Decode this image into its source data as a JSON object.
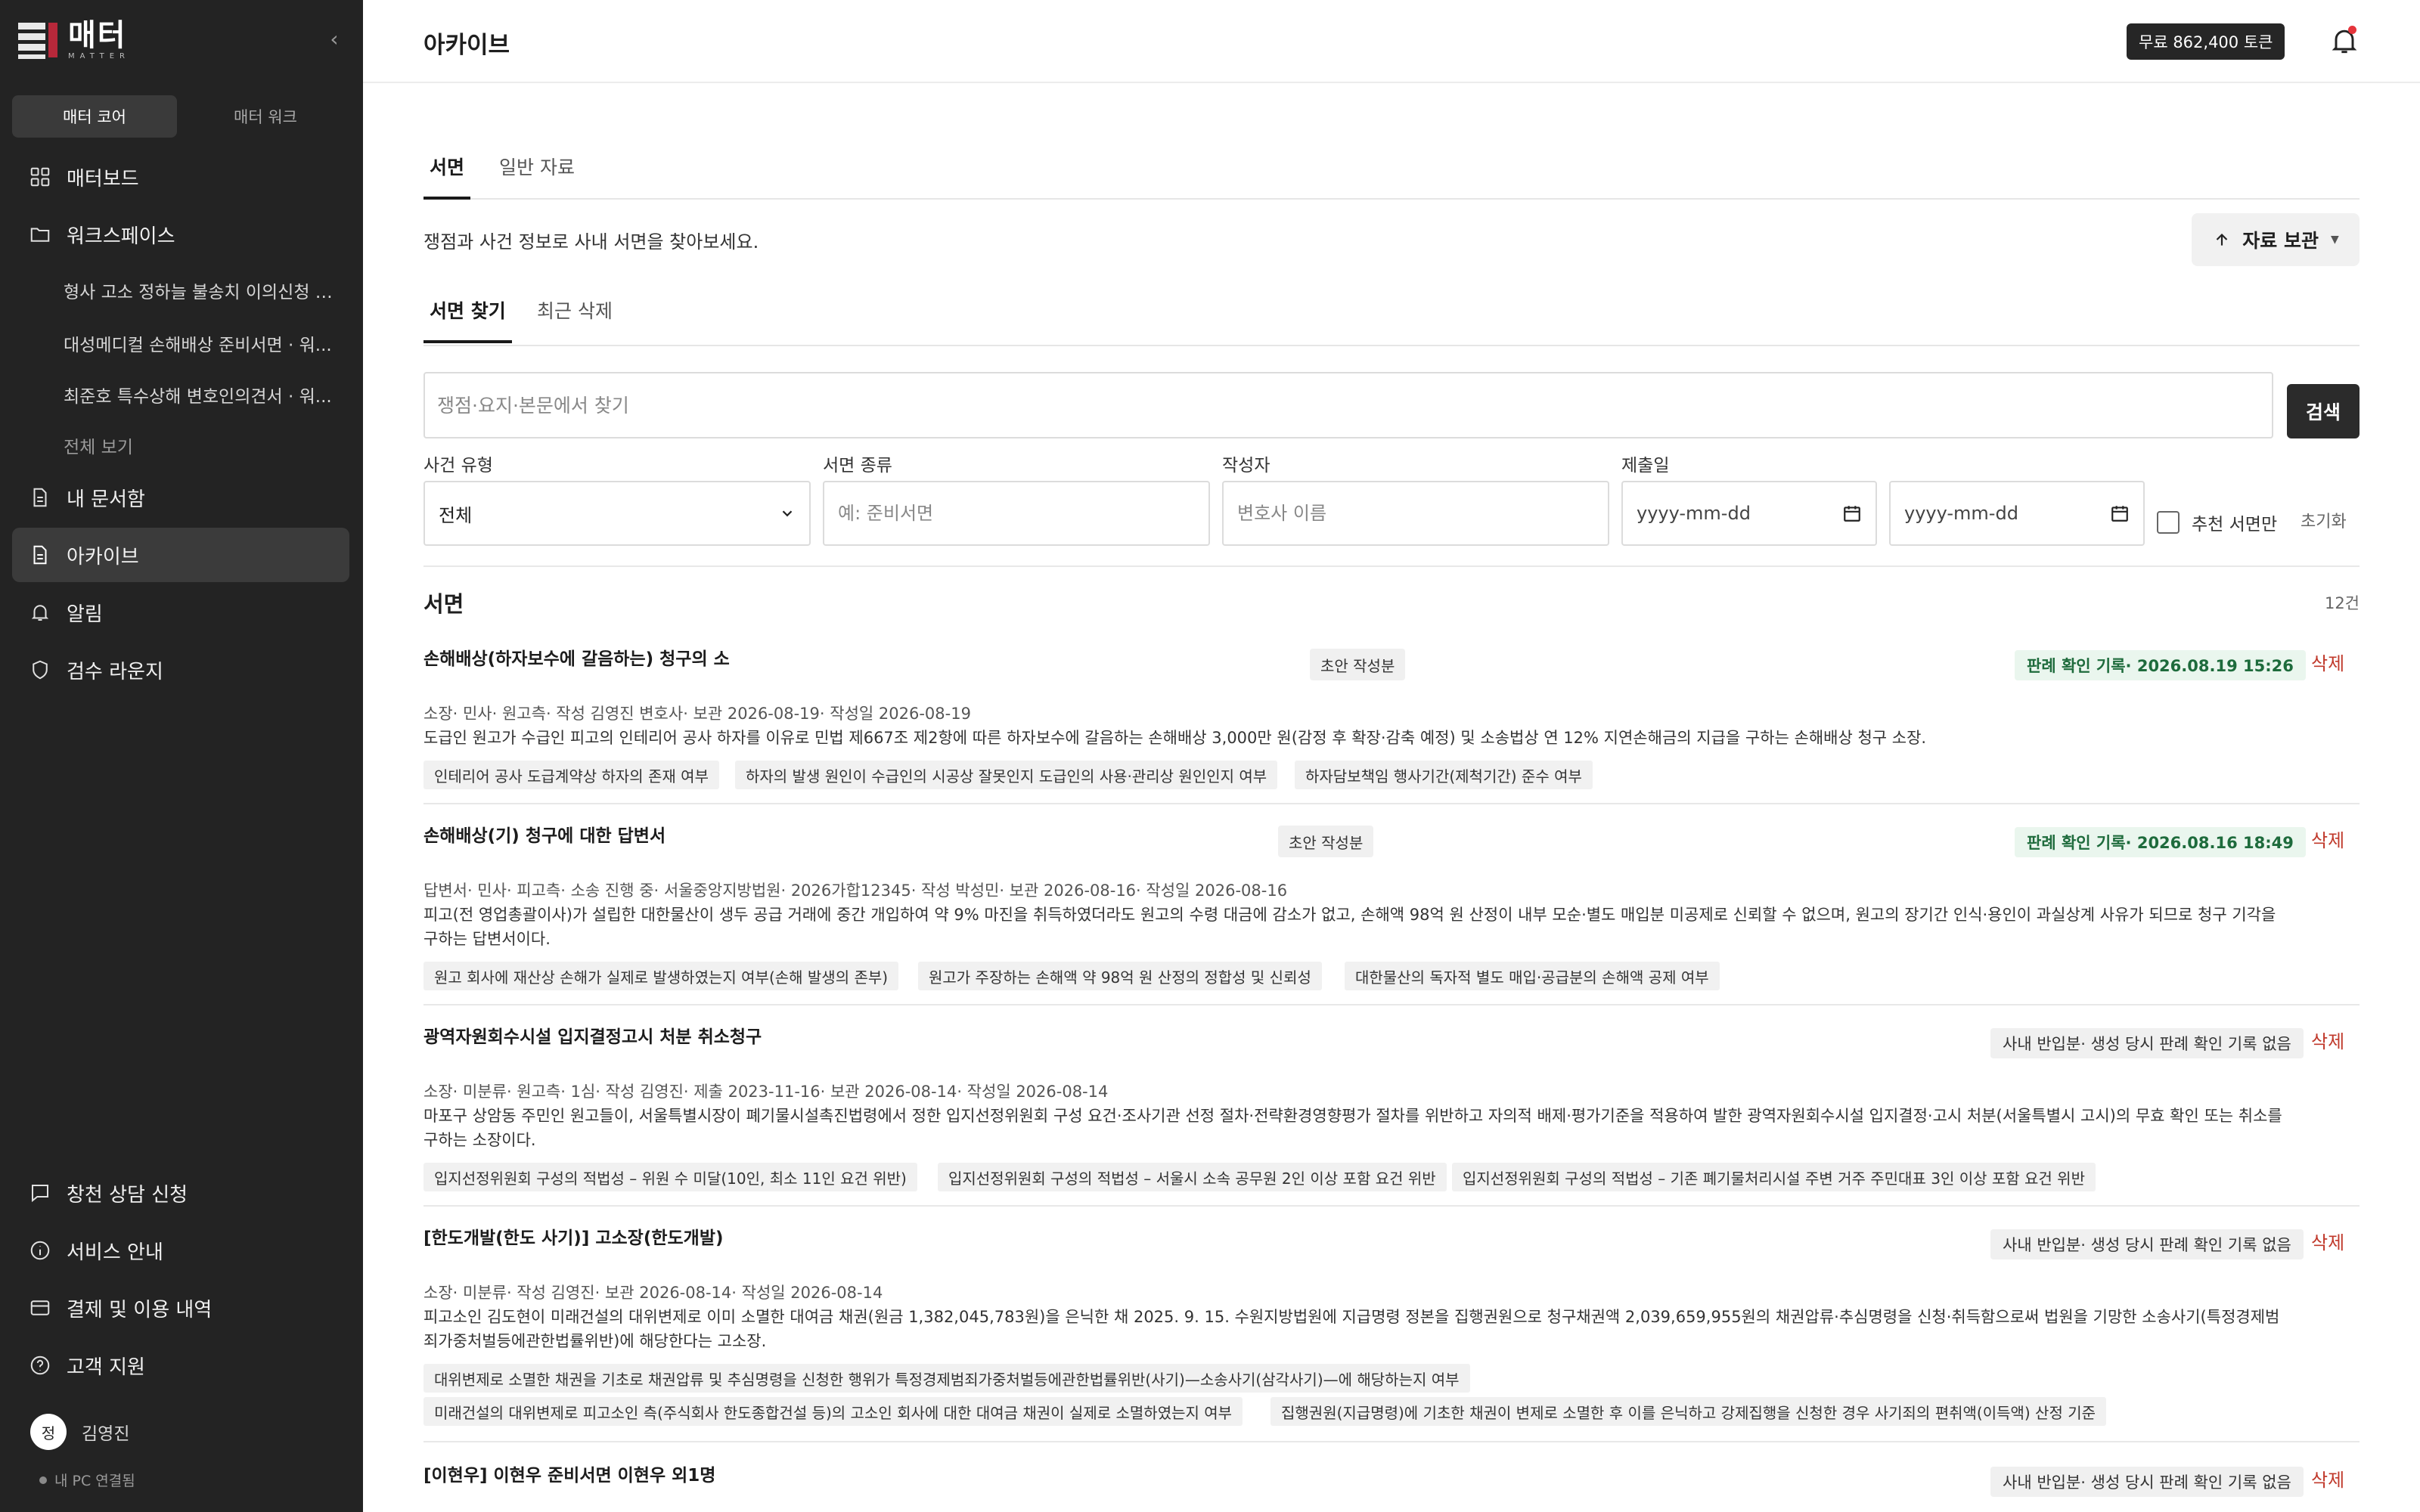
{
  "sidebar": {
    "logo_text": "매터",
    "logo_sub": "MATTER",
    "mode_tabs": [
      "매터 코어",
      "매터 워크"
    ],
    "nav": {
      "dashboard": "매터보드",
      "workspace": "워크스페이스",
      "my_docs": "내 문서함",
      "archive": "아카이브",
      "alerts": "알림",
      "review": "검수 라운지",
      "consult": "창천 상담 신청",
      "guide": "서비스 안내",
      "billing": "결제 및 이용 내역",
      "support": "고객 지원"
    },
    "workspace_items": [
      "형사 고소 정하늘 불송치 이의신청 · ...",
      "대성메디컬 손해배상 준비서면 · 워...",
      "최준호 특수상해 변호인의견서 · 워..."
    ],
    "view_all": "전체 보기",
    "user": {
      "initial": "정",
      "name": "김영진"
    },
    "pc_status": "내 PC 연결됨"
  },
  "header": {
    "title": "아카이브",
    "tokens": "무료 862,400 토큰"
  },
  "tabs_main": [
    "서면",
    "일반 자료"
  ],
  "intro": "쟁점과 사건 정보로 사내 서면을 찾아보세요.",
  "archive_button": "자료 보관",
  "tabs_sub": [
    "서면 찾기",
    "최근 삭제"
  ],
  "search": {
    "placeholder": "쟁점·요지·본문에서 찾기",
    "button": "검색"
  },
  "filters": {
    "case_type_label": "사건 유형",
    "case_type_value": "전체",
    "doc_type_label": "서면 종류",
    "doc_type_placeholder": "예: 준비서면",
    "author_label": "작성자",
    "author_placeholder": "변호사 이름",
    "date_label": "제출일",
    "date_placeholder": "yyyy-mm-dd",
    "recommended": "추천 서면만",
    "reset": "초기화"
  },
  "list": {
    "title": "서면",
    "count": "12건",
    "delete_label": "삭제",
    "items": [
      {
        "title": "손해배상(하자보수에 갈음하는) 청구의 소",
        "badge": "초안 작성분",
        "record": "판례 확인 기록· 2026.08.19 15:26",
        "meta": "소장· 민사· 원고측· 작성 김영진 변호사· 보관 2026-08-19· 작성일 2026-08-19",
        "summary": "도급인 원고가 수급인 피고의 인테리어 공사 하자를 이유로 민법 제667조 제2항에 따른 하자보수에 갈음하는 손해배상 3,000만 원(감정 후 확장·감축 예정) 및 소송법상 연 12% 지연손해금의 지급을 구하는 손해배상 청구 소장.",
        "chips": [
          "인테리어 공사 도급계약상 하자의 존재 여부",
          "하자의 발생 원인이 수급인의 시공상 잘못인지 도급인의 사용·관리상 원인인지 여부",
          "하자담보책임 행사기간(제척기간) 준수 여부"
        ]
      },
      {
        "title": "손해배상(기) 청구에 대한 답변서",
        "badge": "초안 작성분",
        "record": "판례 확인 기록· 2026.08.16 18:49",
        "meta": "답변서· 민사· 피고측· 소송 진행 중· 서울중앙지방법원· 2026가합12345· 작성 박성민· 보관 2026-08-16· 작성일 2026-08-16",
        "summary": "피고(전 영업총괄이사)가 설립한 대한물산이 생두 공급 거래에 중간 개입하여 약 9% 마진을 취득하였더라도 원고의 수령 대금에 감소가 없고, 손해액 98억 원 산정이 내부 모순·별도 매입분 미공제로 신뢰할 수 없으며, 원고의 장기간 인식·용인이 과실상계 사유가 되므로 청구 기각을 구하는 답변서이다.",
        "chips": [
          "원고 회사에 재산상 손해가 실제로 발생하였는지 여부(손해 발생의 존부)",
          "원고가 주장하는 손해액 약 98억 원 산정의 정합성 및 신뢰성",
          "대한물산의 독자적 별도 매입·공급분의 손해액 공제 여부"
        ]
      },
      {
        "title": "광역자원회수시설 입지결정고시 처분 취소청구",
        "record": "사내 반입분· 생성 당시 판례 확인 기록 없음",
        "meta": "소장· 미분류· 원고측· 1심· 작성 김영진· 제출 2023-11-16· 보관 2026-08-14· 작성일 2026-08-14",
        "summary": "마포구 상암동 주민인 원고들이, 서울특별시장이 폐기물시설촉진법령에서 정한 입지선정위원회 구성 요건·조사기관 선정 절차·전략환경영향평가 절차를 위반하고 자의적 배제·평가기준을 적용하여 발한 광역자원회수시설 입지결정·고시 처분(서울특별시 고시)의 무효 확인 또는 취소를 구하는 소장이다.",
        "chips": [
          "입지선정위원회 구성의 적법성 – 위원 수 미달(10인, 최소 11인 요건 위반)",
          "입지선정위원회 구성의 적법성 – 서울시 소속 공무원 2인 이상 포함 요건 위반",
          "입지선정위원회 구성의 적법성 – 기존 폐기물처리시설 주변 거주 주민대표 3인 이상 포함 요건 위반"
        ]
      },
      {
        "title": "[한도개발(한도 사기)] 고소장(한도개발)",
        "record": "사내 반입분· 생성 당시 판례 확인 기록 없음",
        "meta": "소장· 미분류· 작성 김영진· 보관 2026-08-14· 작성일 2026-08-14",
        "summary": "피고소인 김도현이 미래건설의 대위변제로 이미 소멸한 대여금 채권(원금 1,382,045,783원)을 은닉한 채 2025. 9. 15. 수원지방법원에 지급명령 정본을 집행권원으로 청구채권액 2,039,659,955원의 채권압류·추심명령을 신청·취득함으로써 법원을 기망한 소송사기(특정경제범죄가중처벌등에관한법률위반)에 해당한다는 고소장.",
        "chips": [
          "대위변제로 소멸한 채권을 기초로 채권압류 및 추심명령을 신청한 행위가 특정경제범죄가중처벌등에관한법률위반(사기)—소송사기(삼각사기)—에 해당하는지 여부",
          "미래건설의 대위변제로 피고소인 측(주식회사 한도종합건설 등)의 고소인 회사에 대한 대여금 채권이 실제로 소멸하였는지 여부",
          "집행권원(지급명령)에 기초한 채권이 변제로 소멸한 후 이를 은닉하고 강제집행을 신청한 경우 사기죄의 편취액(이득액) 산정 기준"
        ]
      },
      {
        "title": "[이현우] 이현우 준비서면 이현우 외1명",
        "record": "사내 반입분· 생성 당시 판례 확인 기록 없음"
      }
    ]
  }
}
